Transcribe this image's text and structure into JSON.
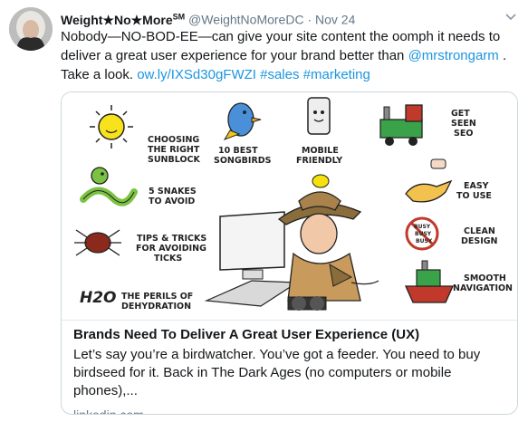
{
  "tweet": {
    "display_name": "Weight★No★More",
    "name_badge": "SM",
    "handle": "@WeightNoMoreDC",
    "separator": "·",
    "date": "Nov 24",
    "text_before_mention": "Nobody—NO-BOD-EE—can give your site content the oomph it needs to deliver a great user experience for your brand better than ",
    "mention": "@mrstrongarm",
    "text_after_mention": " . Take a look. ",
    "link": "ow.ly/IXSd30gFWZI",
    "hashtags": [
      "#sales",
      "#marketing"
    ]
  },
  "card": {
    "illustration_labels": {
      "sunblock": [
        "CHOOSING",
        "THE RIGHT",
        "SUNBLOCK"
      ],
      "songbirds": [
        "10 BEST",
        "SONGBIRDS"
      ],
      "mobile": [
        "MOBILE",
        "FRIENDLY"
      ],
      "seo": [
        "GET",
        "SEEN",
        "SEO"
      ],
      "snakes": [
        "5 SNAKES",
        "TO AVOID"
      ],
      "easy": [
        "EASY",
        "TO USE"
      ],
      "ticks": [
        "TIPS & TRICKS",
        "FOR AVOIDING",
        "TICKS"
      ],
      "clean": [
        "CLEAN",
        "DESIGN"
      ],
      "busy": [
        "BUSY",
        "BUSY",
        "BUSY"
      ],
      "navigation": [
        "SMOOTH",
        "NAVIGATION"
      ],
      "dehydration": [
        "THE PERILS OF",
        "DEHYDRATION"
      ],
      "h2o": "H2O"
    },
    "title": "Brands Need To Deliver A Great User Experience (UX)",
    "description": "Let’s say you’re a birdwatcher. You’ve got a feeder. You need to buy birdseed for it. Back in The Dark Ages (no computers or mobile phones),...",
    "domain": "linkedin.com"
  },
  "colors": {
    "link": "#1b95e0",
    "muted": "#657786",
    "text": "#14171a",
    "border": "#ccd6dd"
  }
}
